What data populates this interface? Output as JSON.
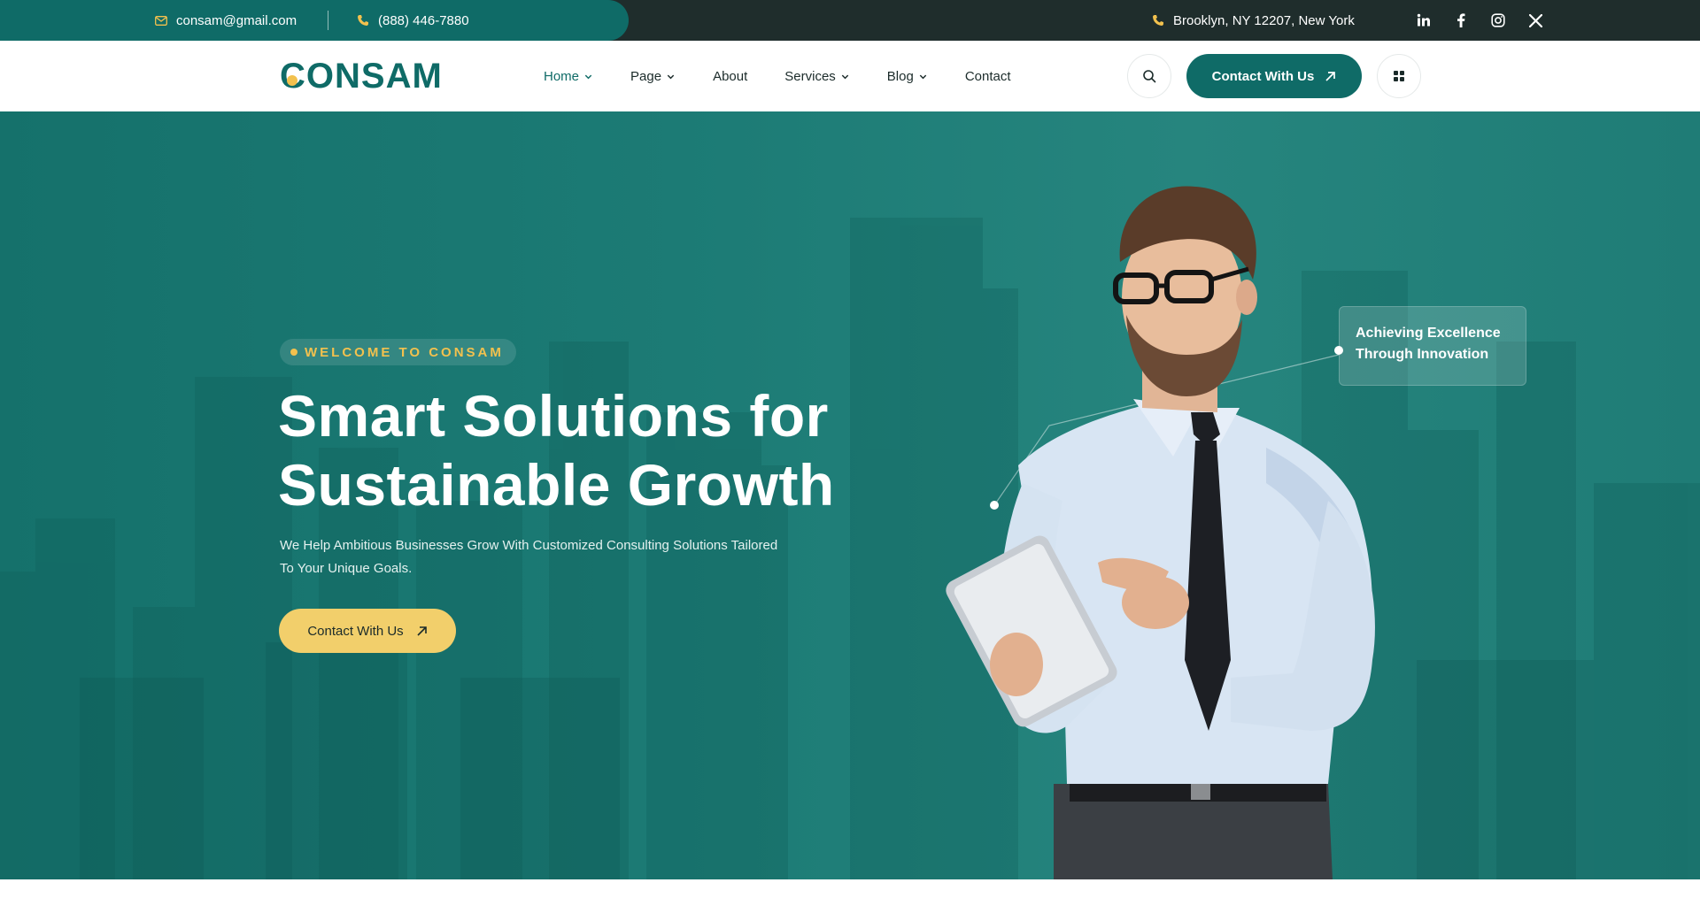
{
  "topbar": {
    "email": "consam@gmail.com",
    "phone": "(888) 446-7880",
    "address": "Brooklyn, NY 12207, New York",
    "socials": [
      "linkedin-icon",
      "facebook-icon",
      "instagram-icon",
      "x-icon"
    ]
  },
  "brand": {
    "logo_text": "ONSAM",
    "logo_letter": "C"
  },
  "nav": {
    "items": [
      {
        "label": "Home",
        "dropdown": true
      },
      {
        "label": "Page",
        "dropdown": true
      },
      {
        "label": "About",
        "dropdown": false
      },
      {
        "label": "Services",
        "dropdown": true
      },
      {
        "label": "Blog",
        "dropdown": true
      },
      {
        "label": "Contact",
        "dropdown": false
      }
    ],
    "cta_label": "Contact With Us"
  },
  "hero": {
    "badge": "WELCOME TO CONSAM",
    "title_line1": "Smart Solutions for",
    "title_line2": "Sustainable Growth",
    "description_line1": "We Help Ambitious Businesses Grow With Customized Consulting Solutions Tailored",
    "description_line2": "To Your Unique Goals.",
    "cta_label": "Contact With Us",
    "card_line1": "Achieving Excellence",
    "card_line2": "Through Innovation"
  },
  "colors": {
    "primary": "#0f6b67",
    "accent": "#f2c14e",
    "topbar_dark": "#1f2d2c",
    "hero_bg": "#1c7b75"
  }
}
